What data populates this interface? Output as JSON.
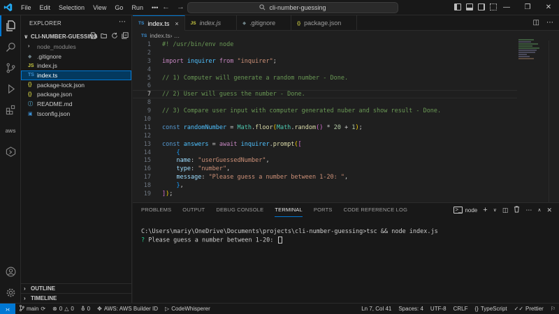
{
  "titlebar": {
    "menu": [
      "File",
      "Edit",
      "Selection",
      "View",
      "Go",
      "Run",
      "•••"
    ],
    "search_text": "cli-number-guessing"
  },
  "sidebar": {
    "title": "EXPLORER",
    "folder": "CLI-NUMBER-GUESSING",
    "files": [
      {
        "label": "node_modules",
        "icon": "›",
        "icon_color": "#cccccc",
        "dim": true
      },
      {
        "label": ".gitignore",
        "icon": "◆",
        "icon_color": "#6d8086",
        "dim": false
      },
      {
        "label": "index.js",
        "icon": "JS",
        "icon_color": "#cbcb41",
        "dim": false
      },
      {
        "label": "index.ts",
        "icon": "TS",
        "icon_color": "#3b8fd3",
        "dim": false,
        "selected": true
      },
      {
        "label": "package-lock.json",
        "icon": "{}",
        "icon_color": "#cbcb41",
        "dim": false
      },
      {
        "label": "package.json",
        "icon": "{}",
        "icon_color": "#cbcb41",
        "dim": false
      },
      {
        "label": "README.md",
        "icon": "ⓘ",
        "icon_color": "#519aba",
        "dim": false
      },
      {
        "label": "tsconfig.json",
        "icon": "▣",
        "icon_color": "#3b8fd3",
        "dim": false
      }
    ],
    "outline_label": "OUTLINE",
    "timeline_label": "TIMELINE"
  },
  "tabs": [
    {
      "label": "index.ts",
      "icon": "TS",
      "icon_color": "#3b8fd3",
      "active": true,
      "italic": false,
      "close": "×"
    },
    {
      "label": "index.js",
      "icon": "JS",
      "icon_color": "#cbcb41",
      "active": false,
      "italic": true,
      "close": ""
    },
    {
      "label": ".gitignore",
      "icon": "◆",
      "icon_color": "#6d8086",
      "active": false,
      "italic": false,
      "close": ""
    },
    {
      "label": "package.json",
      "icon": "{}",
      "icon_color": "#cbcb41",
      "active": false,
      "italic": false,
      "close": ""
    }
  ],
  "breadcrumb": {
    "icon": "TS",
    "file": "index.ts",
    "sep": " › …"
  },
  "code_lines": [
    {
      "n": "1",
      "html": "<span class=\"cmt\">#! /usr/bin/env node</span>"
    },
    {
      "n": "2",
      "html": ""
    },
    {
      "n": "3",
      "html": "<span class=\"kw\">import</span> <span class=\"var\">inquirer</span> <span class=\"kw\">from</span> <span class=\"str\">\"inquirer\"</span>;"
    },
    {
      "n": "4",
      "html": ""
    },
    {
      "n": "5",
      "html": "<span class=\"cmt\">// 1) Computer will generate a random number - Done.</span>"
    },
    {
      "n": "6",
      "html": ""
    },
    {
      "n": "7",
      "html": "<span class=\"cmt\">// 2) User will guess the number - Done.</span>",
      "current": true
    },
    {
      "n": "8",
      "html": ""
    },
    {
      "n": "9",
      "html": "<span class=\"cmt\">// 3) Compare user input with computer generated nuber and show result - Done.</span>"
    },
    {
      "n": "10",
      "html": ""
    },
    {
      "n": "11",
      "html": "<span class=\"kw2\">const</span> <span class=\"var\">randomNumber</span> = <span class=\"cls\">Math</span>.<span class=\"fn\">floor</span><span class=\"br1\">(</span><span class=\"cls\">Math</span>.<span class=\"fn\">random</span><span class=\"br2\">()</span> * <span class=\"num\">20</span> + <span class=\"num\">1</span><span class=\"br1\">)</span>;"
    },
    {
      "n": "12",
      "html": ""
    },
    {
      "n": "13",
      "html": "<span class=\"kw2\">const</span> <span class=\"var\">answers</span> = <span class=\"kw\">await</span> <span class=\"var\">inquirer</span>.<span class=\"fn\">prompt</span><span class=\"br1\">(</span><span class=\"br2\">[</span>"
    },
    {
      "n": "14",
      "html": "    <span class=\"br3\">{</span>"
    },
    {
      "n": "15",
      "html": "    <span class=\"prop\">name</span>: <span class=\"str\">\"userGuessedNumber\"</span>,"
    },
    {
      "n": "16",
      "html": "    <span class=\"prop\">type</span>: <span class=\"str\">\"number\"</span>,"
    },
    {
      "n": "17",
      "html": "    <span class=\"prop\">message</span>: <span class=\"str\">\"Please guess a number between 1-20: \"</span>,"
    },
    {
      "n": "18",
      "html": "    <span class=\"br3\">}</span>,"
    },
    {
      "n": "19",
      "html": "<span class=\"br2\">]</span><span class=\"br1\">)</span>;"
    }
  ],
  "panel": {
    "tabs": [
      "PROBLEMS",
      "OUTPUT",
      "DEBUG CONSOLE",
      "TERMINAL",
      "PORTS",
      "CODE REFERENCE LOG"
    ],
    "active_tab": "TERMINAL",
    "terminal_name": "node",
    "terminal_lines": {
      "command": "C:\\Users\\mariy\\OneDrive\\Documents\\projects\\cli-number-guessing>tsc && node index.js",
      "prompt_mark": "?",
      "prompt_text": " Please guess a number between 1-20: "
    }
  },
  "statusbar": {
    "branch": "main",
    "errors": "0",
    "warnings": "0",
    "ports": "0",
    "aws": "AWS: AWS Builder ID",
    "codewhisperer": "CodeWhisperer",
    "position": "Ln 7, Col 41",
    "spaces": "Spaces: 4",
    "encoding": "UTF-8",
    "eol": "CRLF",
    "language": "TypeScript",
    "prettier": "Prettier"
  },
  "colors": {
    "accent": "#0078d4",
    "bg": "#1f1f1f",
    "sidebar_bg": "#181818"
  }
}
